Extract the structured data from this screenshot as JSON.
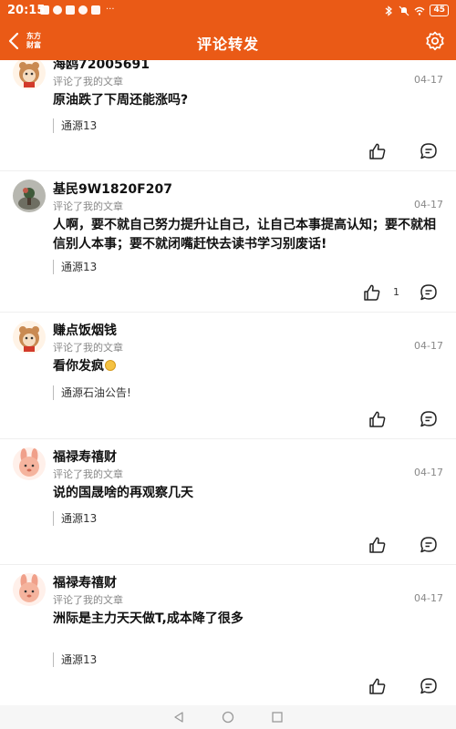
{
  "status_bar": {
    "time": "20:15",
    "battery": "45"
  },
  "header": {
    "logo_line1": "东方",
    "logo_line2": "财富",
    "title": "评论转发"
  },
  "comments": [
    {
      "user": "海鸥72005691",
      "subtitle": "评论了我的文章",
      "date": "04-17",
      "content": "原油跌了下周还能涨吗?",
      "quote": "通源13",
      "like_count": ""
    },
    {
      "user": "基民9W1820F207",
      "subtitle": "评论了我的文章",
      "date": "04-17",
      "content": "人啊，要不就自己努力提升让自己，让自己本事提高认知；要不就相信别人本事；要不就闭嘴赶快去读书学习别废话!",
      "quote": "通源13",
      "like_count": "1"
    },
    {
      "user": "赚点饭烟钱",
      "subtitle": "评论了我的文章",
      "date": "04-17",
      "content": "看你发疯",
      "quote": "通源石油公告!",
      "like_count": ""
    },
    {
      "user": "福禄寿禧财",
      "subtitle": "评论了我的文章",
      "date": "04-17",
      "content": "说的国晟啥的再观察几天",
      "quote": "通源13",
      "like_count": ""
    },
    {
      "user": "福禄寿禧财",
      "subtitle": "评论了我的文章",
      "date": "04-17",
      "content": "洲际是主力天天做T,成本降了很多",
      "quote": "通源13",
      "like_count": ""
    }
  ],
  "icons": {
    "back": "chevron-left-icon",
    "settings": "gear-icon",
    "like": "thumbs-up-icon",
    "comment": "comment-bubble-icon",
    "nav_back": "triangle-back-icon",
    "nav_home": "circle-home-icon",
    "nav_recent": "square-recent-icon"
  },
  "colors": {
    "accent": "#ea5a16"
  }
}
